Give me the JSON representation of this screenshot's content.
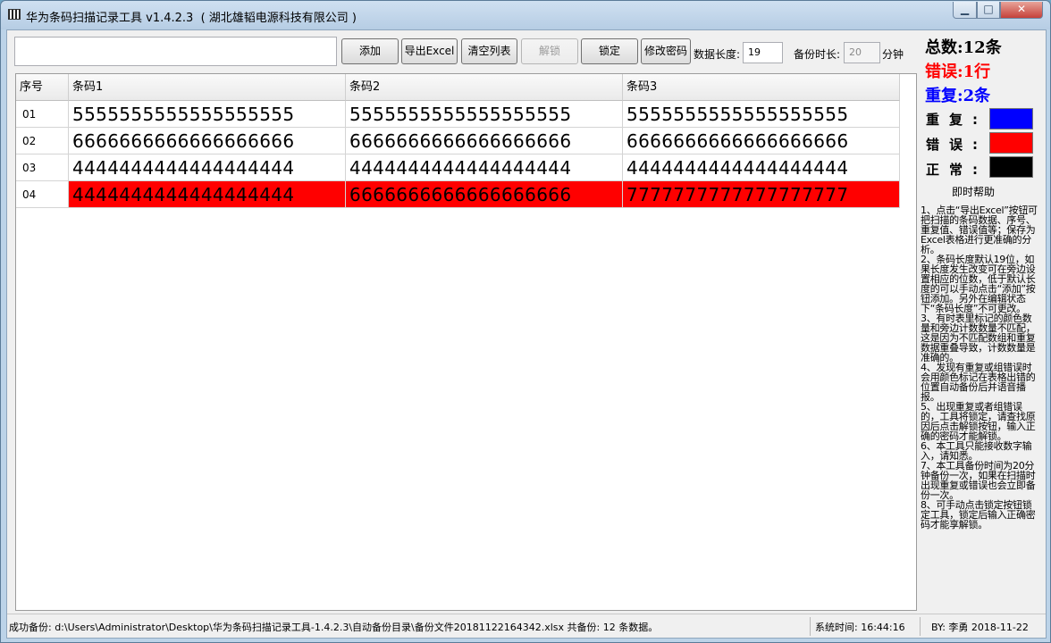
{
  "window": {
    "title": "华为条码扫描记录工具 v1.4.2.3  ( 湖北雄韬电源科技有限公司 )",
    "controls": {
      "minimize": "▁",
      "maximize": "□",
      "close": "✕"
    }
  },
  "toolbar": {
    "scan_value": "",
    "add": "添加",
    "export_excel": "导出Excel",
    "clear_list": "清空列表",
    "unlock": "解锁",
    "lock": "锁定",
    "change_password": "修改密码",
    "barcode_length_label": "数据长度:",
    "barcode_length_value": "19",
    "backup_interval_label": "备份时长:",
    "backup_interval_value": "20",
    "minutes_unit": "分钟"
  },
  "table": {
    "headers": [
      "序号",
      "条码1",
      "条码2",
      "条码3"
    ],
    "rows": [
      {
        "index": "01",
        "codes": [
          "5555555555555555555",
          "5555555555555555555",
          "5555555555555555555"
        ],
        "state": "normal"
      },
      {
        "index": "02",
        "codes": [
          "6666666666666666666",
          "6666666666666666666",
          "6666666666666666666"
        ],
        "state": "normal"
      },
      {
        "index": "03",
        "codes": [
          "4444444444444444444",
          "4444444444444444444",
          "4444444444444444444"
        ],
        "state": "normal"
      },
      {
        "index": "04",
        "codes": [
          "4444444444444444444",
          "6666666666666666666",
          "7777777777777777777"
        ],
        "state": "error"
      }
    ]
  },
  "stats": {
    "total": "总数:12条",
    "error": "错误:1行",
    "duplicate": "重复:2条",
    "colors": {
      "total": "#000000",
      "error": "#ff0000",
      "duplicate": "#0000ff"
    }
  },
  "legend": {
    "duplicate_label": "重复:",
    "error_label": "错误:",
    "normal_label": "正常:",
    "duplicate_color": "#0000ff",
    "error_color": "#ff0000",
    "normal_color": "#000000"
  },
  "help": {
    "title": "即时帮助",
    "paragraphs": [
      "1、点击“导出Excel”按钮可把扫描的条码数据、序号、重复值、错误值等；保存为Excel表格进行更准确的分析。",
      "2、条码长度默认19位，如果长度发生改变可在旁边设置相应的位数，低于默认长度的可以手动点击“添加”按钮添加。另外在编辑状态下“条码长度”不可更改。",
      "3、有时表里标记的颜色数量和旁边计数数量不匹配，这是因为不匹配数组和重复数据重叠导致，计数数量是准确的。",
      "4、发现有重复或组错误时会用颜色标记在表格出错的位置自动备份后并语音播报。",
      "5、出现重复或者组错误的，工具将锁定，请查找原因后点击解锁按钮，输入正确的密码才能解锁。",
      "6、本工具只能接收数字输入，请知悉。",
      "7、本工具备份时间为20分钟备份一次，如果在扫描时出现重复或错误也会立即备份一次。",
      "8、可手动点击锁定按钮锁定工具，锁定后输入正确密码才能享解锁。"
    ]
  },
  "statusbar": {
    "backup_message": "成功备份: d:\\Users\\Administrator\\Desktop\\华为条码扫描记录工具-1.4.2.3\\自动备份目录\\备份文件20181122164342.xlsx 共备份: 12 条数据。",
    "system_time": "系统时间: 16:44:16",
    "author": "BY: 李勇  2018-11-22"
  }
}
